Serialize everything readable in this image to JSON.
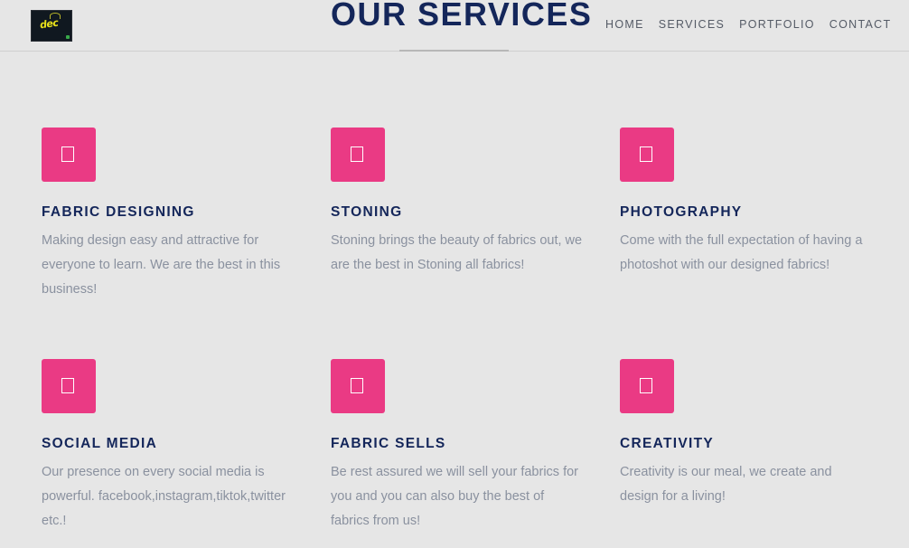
{
  "header": {
    "logo_text": "dec",
    "title": "OUR SERVICES",
    "nav": [
      "HOME",
      "SERVICES",
      "PORTFOLIO",
      "CONTACT"
    ]
  },
  "colors": {
    "accent": "#ea3a84",
    "heading": "#14265a",
    "body_text": "#8a919f",
    "background": "#e6e6e6"
  },
  "services": [
    {
      "icon": "service-icon",
      "title": "FABRIC DESIGNING",
      "text": "Making design easy and attractive for everyone to learn. We are the best in this business!"
    },
    {
      "icon": "service-icon",
      "title": "STONING",
      "text": "Stoning brings the beauty of fabrics out, we are the best in Stoning all fabrics!"
    },
    {
      "icon": "service-icon",
      "title": "PHOTOGRAPHY",
      "text": "Come with the full expectation of having a photoshot with our designed fabrics!"
    },
    {
      "icon": "service-icon",
      "title": "SOCIAL MEDIA",
      "text": "Our presence on every social media is powerful. facebook,instagram,tiktok,twitter etc.!"
    },
    {
      "icon": "service-icon",
      "title": "FABRIC SELLS",
      "text": "Be rest assured we will sell your fabrics for you and you can also buy the best of fabrics from us!"
    },
    {
      "icon": "service-icon",
      "title": "CREATIVITY",
      "text": "Creativity is our meal, we create and design for a living!"
    }
  ]
}
